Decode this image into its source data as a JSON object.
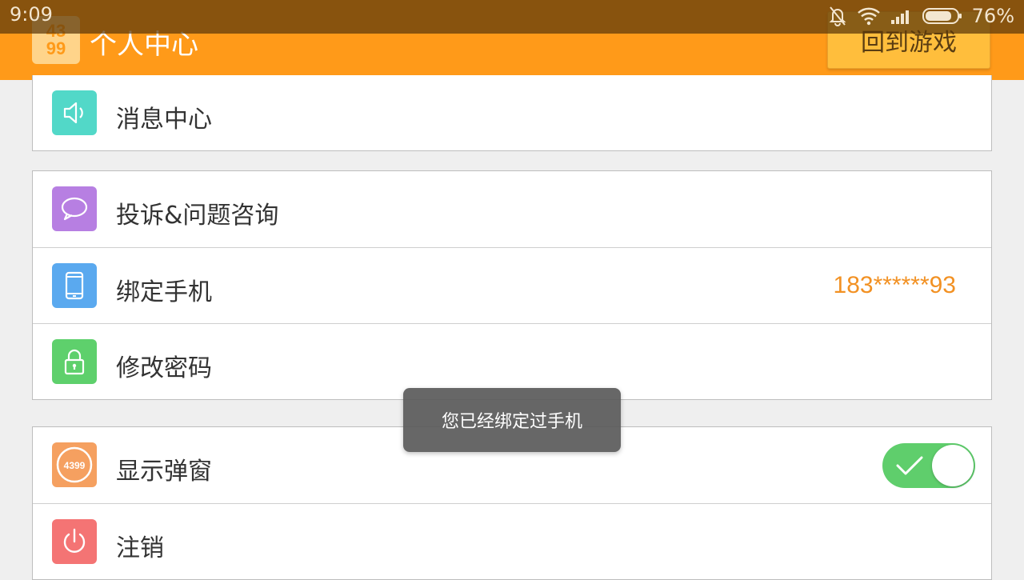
{
  "status_bar": {
    "time": "9:09",
    "battery": "76%",
    "icons": [
      "bell-off-icon",
      "wifi-icon",
      "signal-icon",
      "battery-icon"
    ]
  },
  "header": {
    "logo_text_top": "43",
    "logo_text_bottom": "99",
    "title": "个人中心",
    "back_button": "回到游戏",
    "color": "#ff9a19"
  },
  "groups": [
    {
      "items": [
        {
          "label": "消息中心",
          "icon": "speaker-icon",
          "icon_color": "#52d8c8"
        }
      ]
    },
    {
      "items": [
        {
          "label": "投诉&问题咨询",
          "icon": "chat-bubble-icon",
          "icon_color": "#b77fe2"
        },
        {
          "label": "绑定手机",
          "icon": "phone-icon",
          "icon_color": "#5aa9ef",
          "value": "183******93"
        },
        {
          "label": "修改密码",
          "icon": "lock-icon",
          "icon_color": "#5ed06c"
        }
      ]
    },
    {
      "items": [
        {
          "label": "显示弹窗",
          "icon": "4399-logo-icon",
          "icon_color": "#f5a060",
          "icon_text": "4399",
          "toggle": true
        },
        {
          "label": "注销",
          "icon": "power-icon",
          "icon_color": "#f47474"
        }
      ]
    }
  ],
  "toast": {
    "message": "您已经绑定过手机"
  }
}
